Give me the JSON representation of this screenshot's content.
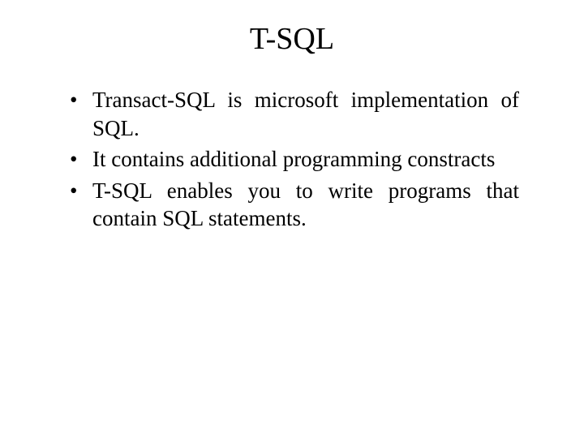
{
  "title": "T-SQL",
  "bullets": [
    "Transact-SQL is microsoft implementation of SQL.",
    "It contains additional programming constracts",
    "T-SQL enables you to write programs that contain SQL statements."
  ]
}
